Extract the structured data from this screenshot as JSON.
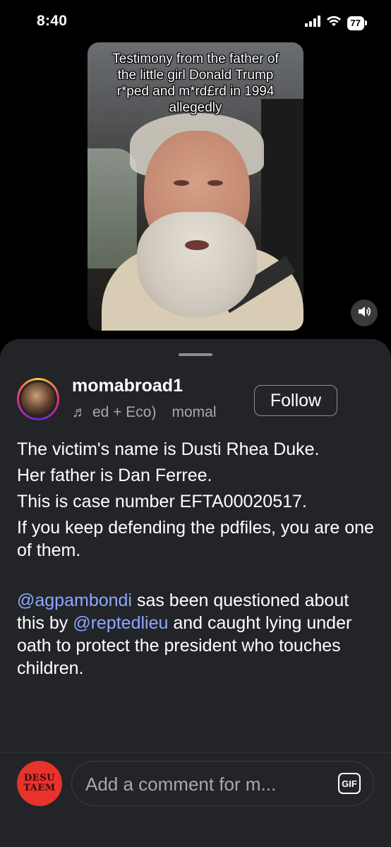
{
  "status_bar": {
    "time": "8:40",
    "battery": "77"
  },
  "video": {
    "caption": "Testimony from the father of the little girl Donald Trump r*ped and m*rd£rd in 1994 allegedly"
  },
  "post": {
    "username": "momabroad1",
    "audio_title": "ed + Eco)",
    "audio_user": "momal",
    "follow_label": "Follow",
    "paragraphs": [
      "The victim's name is Dusti Rhea Duke.",
      "Her father is Dan Ferree.",
      "This is case number EFTA00020517.",
      "If you keep defending the pdfiles, you are one of them."
    ],
    "mention_paragraph": {
      "mention1": "@agpambondi",
      "text1": " sas been questioned about this by ",
      "mention2": "@reptedlieu",
      "text2": " and caught lying under oath to protect the president who touches children."
    }
  },
  "commenter_avatar": {
    "line1": "DESU",
    "line2": "TAEM"
  },
  "comment": {
    "placeholder": "Add a comment for m...",
    "gif_label": "GIF"
  },
  "icons": {
    "signal": "signal-icon",
    "wifi": "wifi-icon",
    "volume": "speaker-icon",
    "music": "music-note-icon"
  }
}
